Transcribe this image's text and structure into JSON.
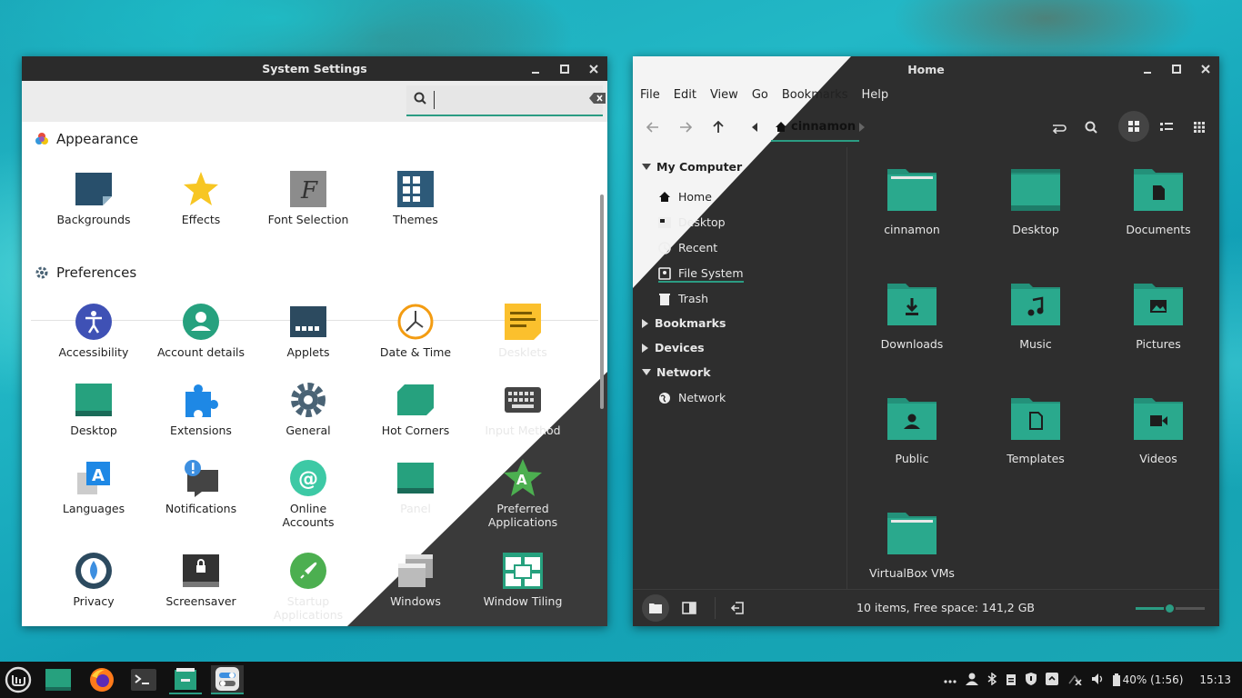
{
  "colors": {
    "accent": "#2b9c83",
    "dark_bg": "#2e2e2e",
    "panel_bg": "#111111"
  },
  "settings": {
    "title": "System Settings",
    "search_placeholder": "",
    "sections": [
      {
        "title": "Appearance",
        "icon": "palette-icon",
        "items": [
          {
            "label": "Backgrounds",
            "icon": "backgrounds-icon"
          },
          {
            "label": "Effects",
            "icon": "star-icon"
          },
          {
            "label": "Font Selection",
            "icon": "font-icon"
          },
          {
            "label": "Themes",
            "icon": "themes-icon"
          }
        ]
      },
      {
        "title": "Preferences",
        "icon": "gear-icon",
        "items": [
          {
            "label": "Accessibility",
            "icon": "accessibility-icon"
          },
          {
            "label": "Account details",
            "icon": "account-icon"
          },
          {
            "label": "Applets",
            "icon": "applets-icon"
          },
          {
            "label": "Date & Time",
            "icon": "clock-icon"
          },
          {
            "label": "Desklets",
            "icon": "desklets-icon"
          },
          {
            "label": "Desktop",
            "icon": "desktop-icon"
          },
          {
            "label": "Extensions",
            "icon": "puzzle-icon"
          },
          {
            "label": "General",
            "icon": "gear-icon"
          },
          {
            "label": "Hot Corners",
            "icon": "hot-corners-icon"
          },
          {
            "label": "Input Method",
            "icon": "keyboard-icon"
          },
          {
            "label": "Languages",
            "icon": "languages-icon"
          },
          {
            "label": "Notifications",
            "icon": "notifications-icon"
          },
          {
            "label": "Online\nAccounts",
            "icon": "at-icon"
          },
          {
            "label": "Panel",
            "icon": "panel-icon"
          },
          {
            "label": "Preferred\nApplications",
            "icon": "preferred-apps-icon"
          },
          {
            "label": "Privacy",
            "icon": "privacy-icon"
          },
          {
            "label": "Screensaver",
            "icon": "lock-icon"
          },
          {
            "label": "Startup\nApplications",
            "icon": "rocket-icon"
          },
          {
            "label": "Windows",
            "icon": "windows-icon"
          },
          {
            "label": "Window Tiling",
            "icon": "tiling-icon"
          }
        ]
      }
    ]
  },
  "files": {
    "title": "Home",
    "menu": [
      "File",
      "Edit",
      "View",
      "Go",
      "Bookmarks",
      "Help"
    ],
    "breadcrumb": "cinnamon",
    "sidebar": {
      "my_computer": "My Computer",
      "places": [
        "Home",
        "Desktop",
        "Recent",
        "File System",
        "Trash"
      ],
      "bookmarks": "Bookmarks",
      "devices": "Devices",
      "network_header": "Network",
      "network_item": "Network"
    },
    "folders": [
      "cinnamon",
      "Desktop",
      "Documents",
      "Downloads",
      "Music",
      "Pictures",
      "Public",
      "Templates",
      "Videos",
      "VirtualBox VMs"
    ],
    "status": "10 items, Free space: 141,2 GB",
    "zoom_level": 0.5
  },
  "panel": {
    "battery": "40% (1:56)",
    "clock": "15:13"
  }
}
